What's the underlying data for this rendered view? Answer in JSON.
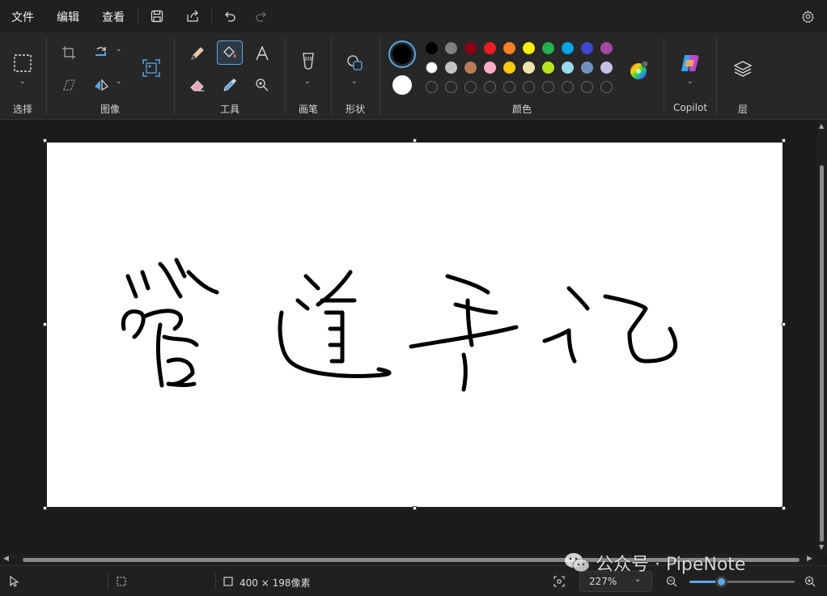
{
  "menubar": {
    "file": "文件",
    "edit": "编辑",
    "view": "查看"
  },
  "ribbon": {
    "groups": {
      "select": "选择",
      "image": "图像",
      "tools": "工具",
      "brushes": "画笔",
      "shapes": "形状",
      "colors": "颜色",
      "copilot": "Copilot",
      "layers": "层"
    },
    "primary_color": "#000000",
    "secondary_color": "#ffffff",
    "palette_row1": [
      "#000000",
      "#7f7f7f",
      "#880015",
      "#ed1c24",
      "#ff7f27",
      "#fff200",
      "#22b14c",
      "#00a2e8",
      "#3f48cc",
      "#a349a4"
    ],
    "palette_row2": [
      "#ffffff",
      "#c3c3c3",
      "#b97a57",
      "#ffaec9",
      "#ffc90e",
      "#efe4b0",
      "#b5e61d",
      "#99d9ea",
      "#7092be",
      "#c8bfe7"
    ],
    "accent": "#5aa7e6"
  },
  "canvas": {
    "handwriting": "管道笔记"
  },
  "status": {
    "dimensions": "400 × 198像素",
    "zoom": "227%"
  },
  "watermark": {
    "text": "公众号 · PipeNote"
  }
}
